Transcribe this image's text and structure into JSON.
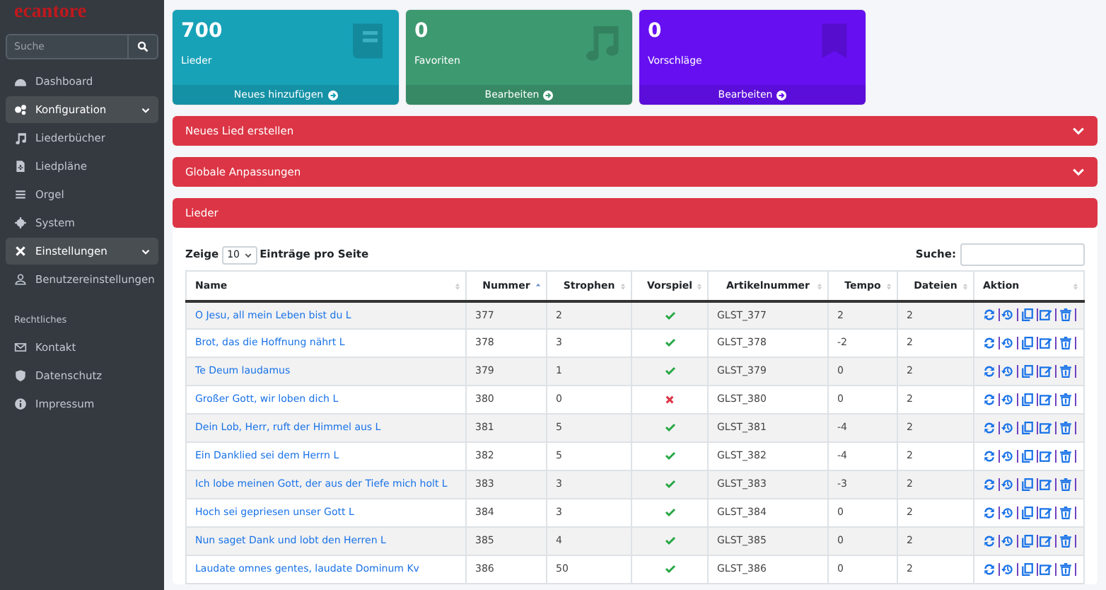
{
  "brand": "ecantore",
  "sidebar": {
    "search_placeholder": "Suche",
    "items": [
      {
        "label": "Dashboard",
        "kind": "link"
      },
      {
        "label": "Konfiguration",
        "kind": "group",
        "expanded": true
      },
      {
        "label": "Liederbücher",
        "kind": "link"
      },
      {
        "label": "Liedpläne",
        "kind": "link"
      },
      {
        "label": "Orgel",
        "kind": "link"
      },
      {
        "label": "System",
        "kind": "link"
      },
      {
        "label": "Einstellungen",
        "kind": "group",
        "expanded": true
      },
      {
        "label": "Benutzereinstellungen",
        "kind": "link"
      },
      {
        "label": "Rechtliches",
        "kind": "header"
      },
      {
        "label": "Kontakt",
        "kind": "link"
      },
      {
        "label": "Datenschutz",
        "kind": "link"
      },
      {
        "label": "Impressum",
        "kind": "link"
      }
    ]
  },
  "stats": [
    {
      "value": "700",
      "label": "Lieder",
      "link": "Neues hinzufügen",
      "color": "#17a2b8"
    },
    {
      "value": "0",
      "label": "Favoriten",
      "link": "Bearbeiten",
      "color": "#3d9970"
    },
    {
      "value": "0",
      "label": "Vorschläge",
      "link": "Bearbeiten",
      "color": "#6610f2"
    }
  ],
  "panels": [
    {
      "title": "Neues Lied erstellen",
      "collapsible": true
    },
    {
      "title": "Globale Anpassungen",
      "collapsible": true
    }
  ],
  "songs": {
    "title": "Lieder",
    "length_prefix": "Zeige",
    "length_value": "10",
    "length_suffix": "Einträge pro Seite",
    "search_label": "Suche:",
    "columns": [
      {
        "label": "Name",
        "sorted_ascending": false
      },
      {
        "label": "Nummer",
        "sorted_ascending": true
      },
      {
        "label": "Strophen",
        "sorted_ascending": false
      },
      {
        "label": "Vorspiel",
        "sorted_ascending": false
      },
      {
        "label": "Artikelnummer",
        "sorted_ascending": false
      },
      {
        "label": "Tempo",
        "sorted_ascending": false
      },
      {
        "label": "Dateien",
        "sorted_ascending": false
      },
      {
        "label": "Aktion",
        "sorted_ascending": false
      }
    ],
    "rows": [
      {
        "name": "O Jesu, all mein Leben bist du L",
        "number": "377",
        "verses": "2",
        "prelude": true,
        "article": "GLST_377",
        "tempo": "2",
        "files": "2"
      },
      {
        "name": "Brot, das die Hoffnung nährt L",
        "number": "378",
        "verses": "3",
        "prelude": true,
        "article": "GLST_378",
        "tempo": "-2",
        "files": "2"
      },
      {
        "name": "Te Deum laudamus",
        "number": "379",
        "verses": "1",
        "prelude": true,
        "article": "GLST_379",
        "tempo": "0",
        "files": "2"
      },
      {
        "name": "Großer Gott, wir loben dich L",
        "number": "380",
        "verses": "0",
        "prelude": false,
        "article": "GLST_380",
        "tempo": "0",
        "files": "2"
      },
      {
        "name": "Dein Lob, Herr, ruft der Himmel aus L",
        "number": "381",
        "verses": "5",
        "prelude": true,
        "article": "GLST_381",
        "tempo": "-4",
        "files": "2"
      },
      {
        "name": "Ein Danklied sei dem Herrn L",
        "number": "382",
        "verses": "5",
        "prelude": true,
        "article": "GLST_382",
        "tempo": "-4",
        "files": "2"
      },
      {
        "name": "Ich lobe meinen Gott, der aus der Tiefe mich holt L",
        "number": "383",
        "verses": "3",
        "prelude": true,
        "article": "GLST_383",
        "tempo": "-3",
        "files": "2"
      },
      {
        "name": "Hoch sei gepriesen unser Gott L",
        "number": "384",
        "verses": "3",
        "prelude": true,
        "article": "GLST_384",
        "tempo": "0",
        "files": "2"
      },
      {
        "name": "Nun saget Dank und lobt den Herren L",
        "number": "385",
        "verses": "4",
        "prelude": true,
        "article": "GLST_385",
        "tempo": "0",
        "files": "2"
      },
      {
        "name": "Laudate omnes gentes, laudate Dominum Kv",
        "number": "386",
        "verses": "50",
        "prelude": true,
        "article": "GLST_386",
        "tempo": "0",
        "files": "2"
      }
    ]
  }
}
